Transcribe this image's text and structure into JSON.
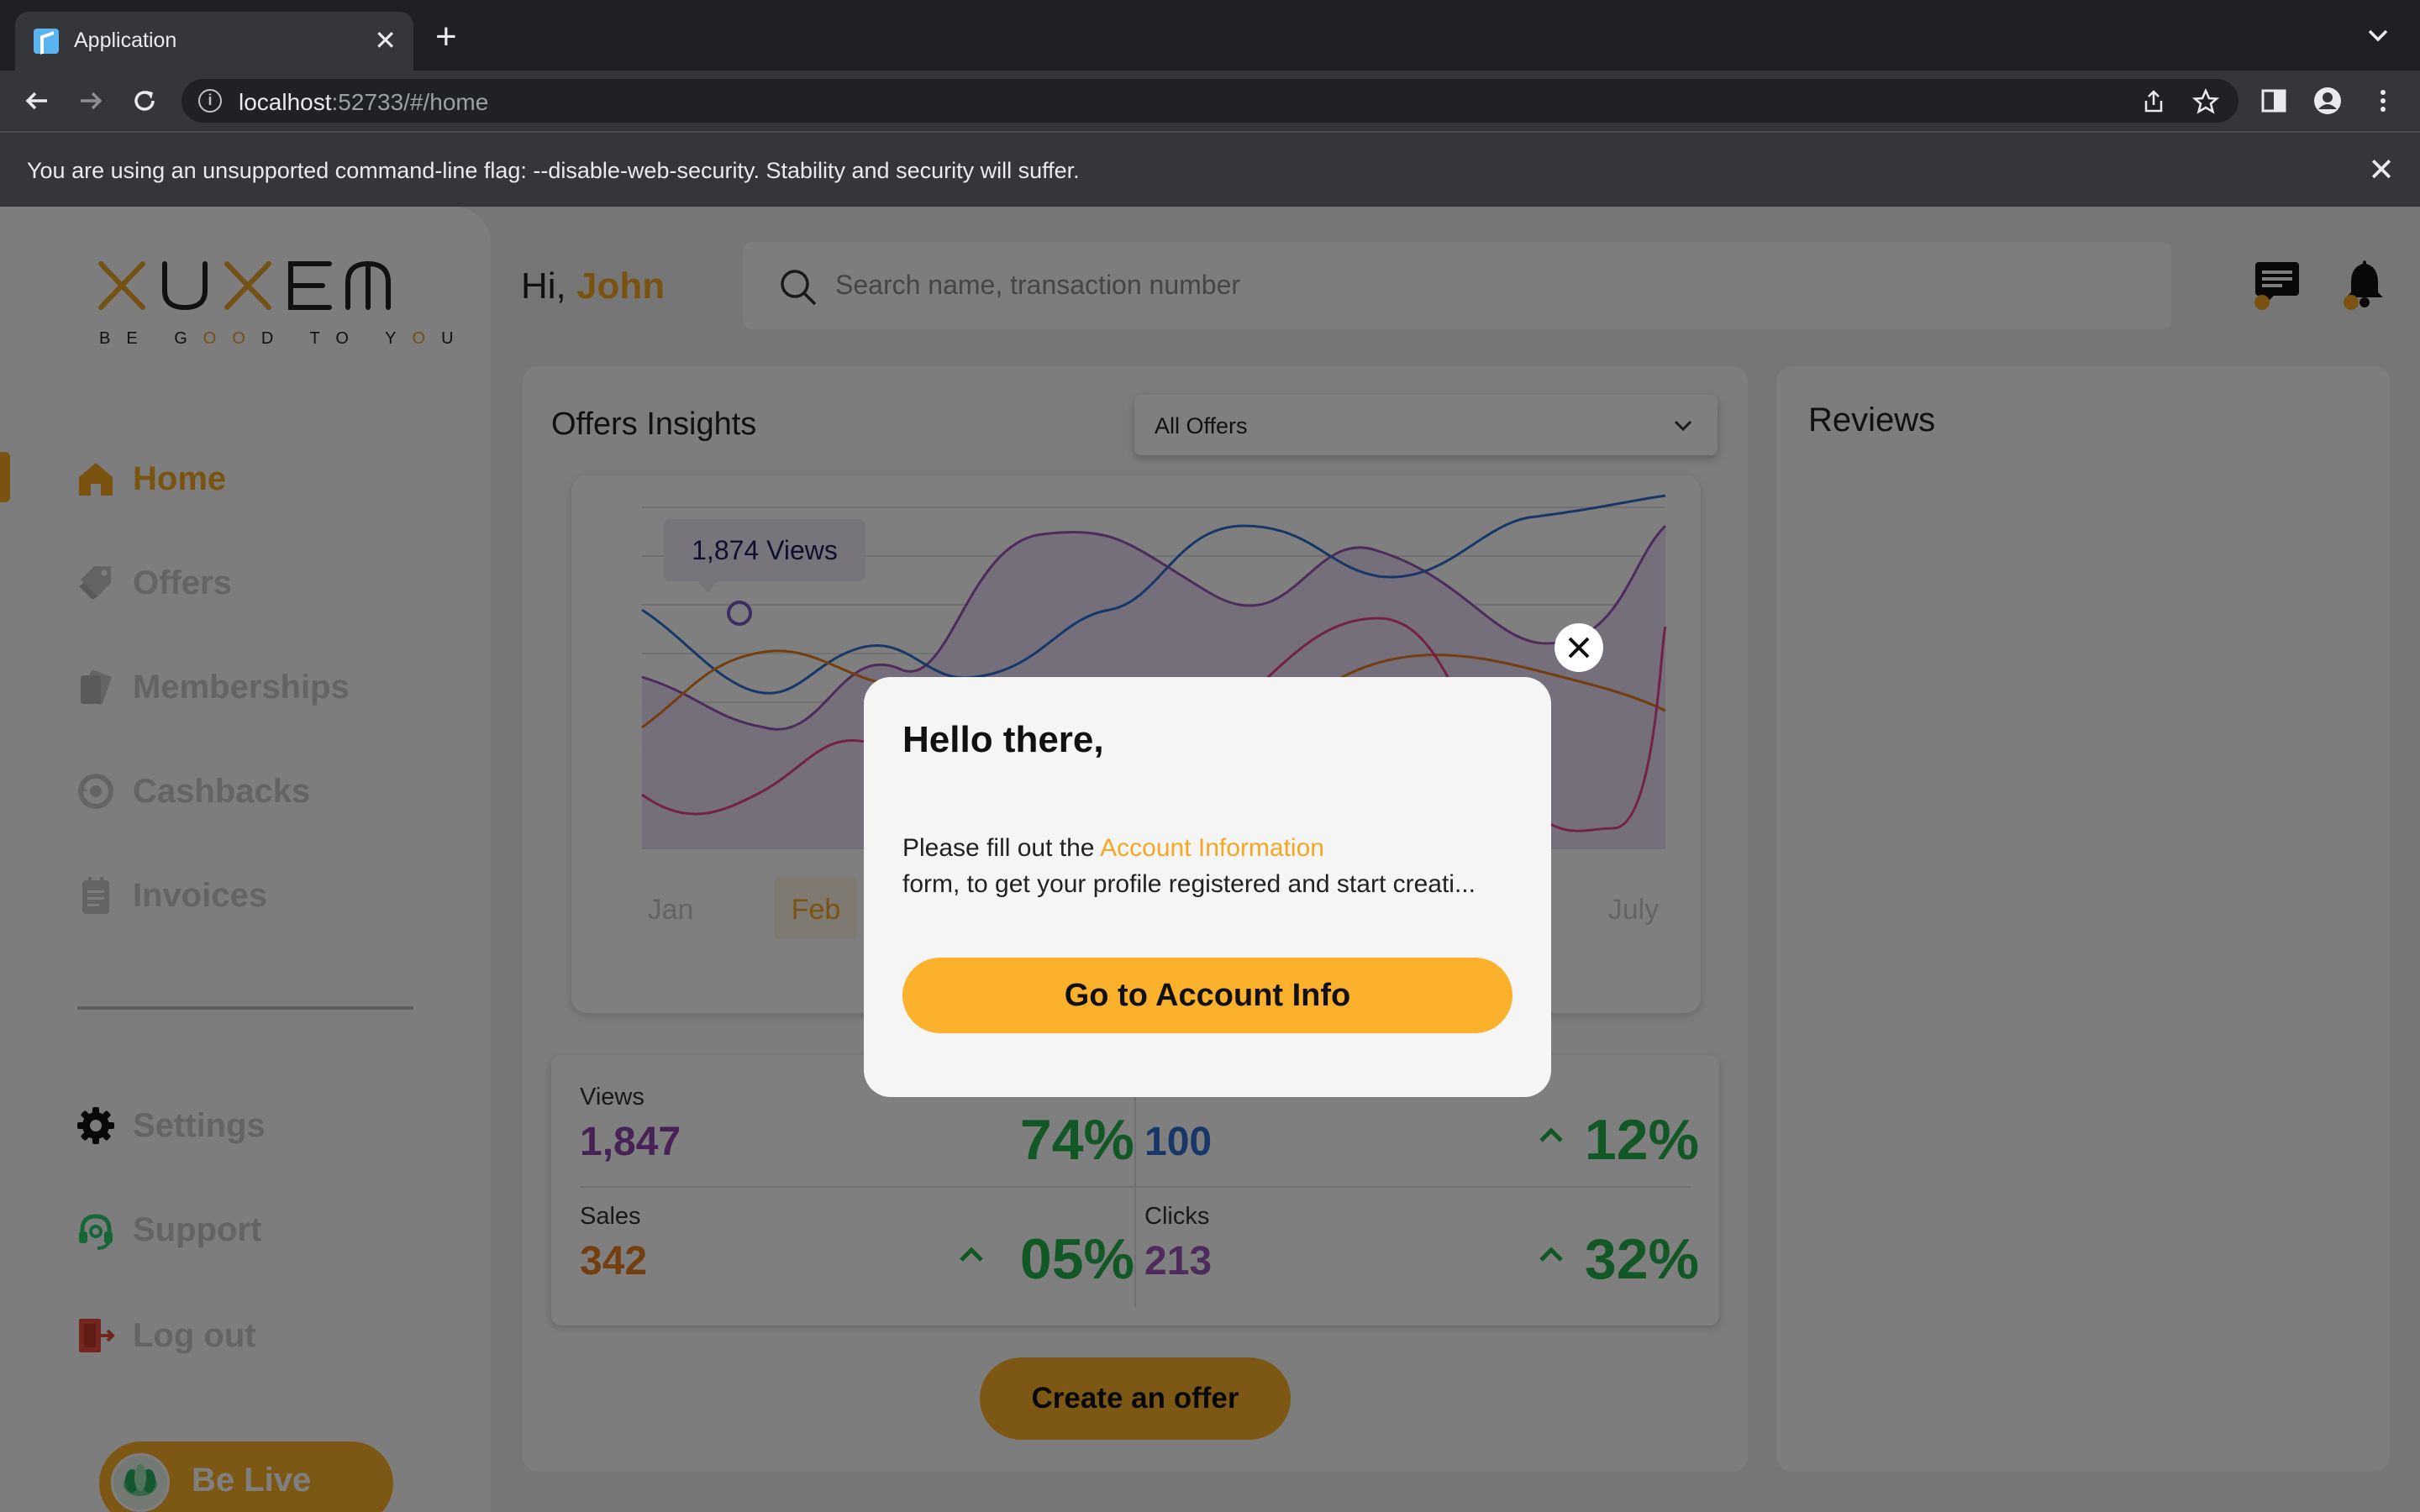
{
  "browser": {
    "tab_title": "Application",
    "tab_close": "✕",
    "new_tab": "+",
    "url_host": "localhost",
    "url_rest": ":52733/#/home",
    "info_icon": "i",
    "infobar_message": "You are using an unsupported command-line flag: --disable-web-security. Stability and security will suffer.",
    "infobar_close": "✕"
  },
  "sidebar": {
    "logo_tagline_parts": [
      "BE G",
      "OO",
      "D TO Y",
      "O",
      "U"
    ],
    "items": [
      {
        "label": "Home",
        "icon": "home-icon"
      },
      {
        "label": "Offers",
        "icon": "tag-icon"
      },
      {
        "label": "Memberships",
        "icon": "card-icon"
      },
      {
        "label": "Cashbacks",
        "icon": "cashback-icon"
      },
      {
        "label": "Invoices",
        "icon": "invoice-icon"
      },
      {
        "label": "Settings",
        "icon": "gear-icon"
      },
      {
        "label": "Support",
        "icon": "headset-icon"
      },
      {
        "label": "Log out",
        "icon": "logout-icon"
      }
    ],
    "active_item": "Home",
    "be_live_label": "Be Live"
  },
  "header": {
    "greeting": "Hi, ",
    "user_name": "John",
    "search_placeholder": "Search name, transaction number"
  },
  "insights": {
    "title": "Offers Insights",
    "filter_value": "All Offers",
    "tooltip": "1,874 Views",
    "months_visible": [
      "Jan",
      "Feb",
      "July"
    ],
    "selected_month": "Feb"
  },
  "stats": {
    "views": {
      "label": "Views",
      "value": "1,847",
      "pct": "74%"
    },
    "top_right": {
      "value": "100",
      "pct": "12%"
    },
    "sales": {
      "label": "Sales",
      "value": "342",
      "pct": "05%"
    },
    "clicks": {
      "label": "Clicks",
      "value": "213",
      "pct": "32%"
    }
  },
  "create_offer_label": "Create an offer",
  "reviews_title": "Reviews",
  "modal": {
    "title": "Hello there,",
    "body_prefix": "Please fill out the ",
    "body_link": "Account Information",
    "body_line2": "form, to get your profile registered and start creati...",
    "button_label": "Go to Account Info"
  },
  "colors": {
    "accent": "#f5a623",
    "button": "#fbb12b",
    "positive": "#22b14c",
    "views": "#8e44ad",
    "sales": "#e67e22",
    "clicks": "#9b59b6",
    "blue": "#2f6fd1"
  }
}
